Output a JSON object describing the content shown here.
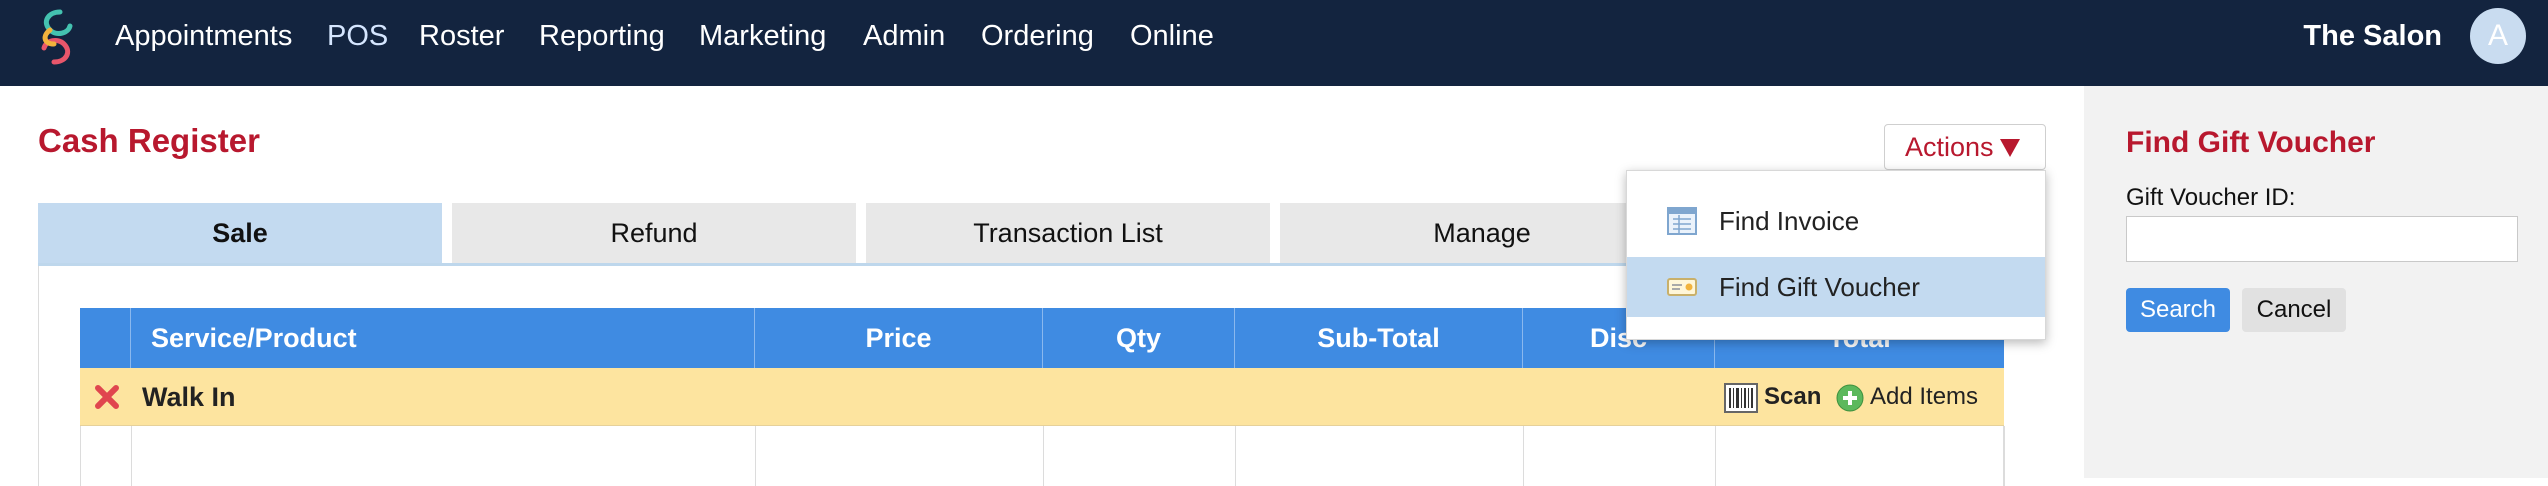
{
  "nav": {
    "items": [
      "Appointments",
      "POS",
      "Roster",
      "Reporting",
      "Marketing",
      "Admin",
      "Ordering",
      "Online"
    ],
    "active": "POS",
    "brand": "The Salon",
    "avatar_initial": "A",
    "logo_icon": "swirl-logo-icon"
  },
  "register": {
    "title": "Cash Register",
    "actions_label": "Actions",
    "tabs": [
      "Sale",
      "Refund",
      "Transaction List",
      "Manage"
    ],
    "active_tab": "Sale"
  },
  "actions_menu": {
    "items": [
      {
        "label": "Find Invoice",
        "icon": "invoice-icon"
      },
      {
        "label": "Find Gift Voucher",
        "icon": "gift-voucher-icon"
      }
    ],
    "highlighted": "Find Gift Voucher"
  },
  "grid": {
    "columns": [
      "Service/Product",
      "Price",
      "Qty",
      "Sub-Total",
      "Disc",
      "Total"
    ],
    "customer_row": {
      "label": "Walk In",
      "scan_label": "Scan",
      "add_label": "Add Items"
    }
  },
  "gift_voucher_panel": {
    "title": "Find Gift Voucher",
    "field_label": "Gift Voucher ID:",
    "field_value": "",
    "search_label": "Search",
    "cancel_label": "Cancel"
  },
  "colors": {
    "nav_bg": "#13243f",
    "accent_red": "#b8182e",
    "header_blue": "#3f8be2",
    "active_tab": "#c3daf0",
    "walkin_row": "#fde49f"
  }
}
